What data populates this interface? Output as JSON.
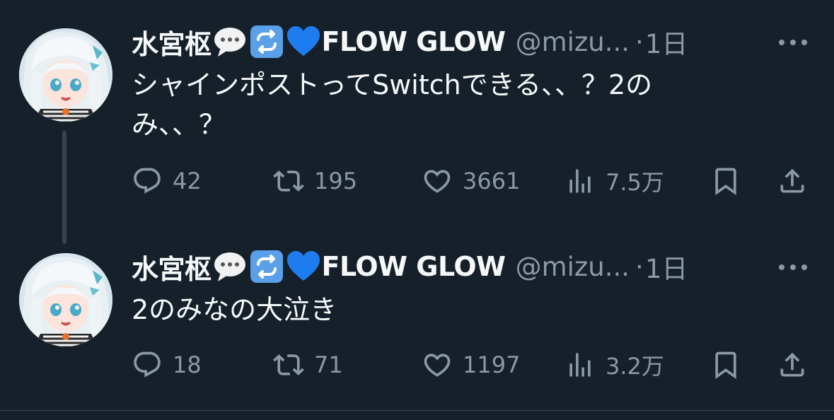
{
  "tweets": [
    {
      "author_name": "水宮枢",
      "author_name_suffix": "FLOW GLOW",
      "name_emojis": [
        "speech-balloon-emoji",
        "repeat-button-emoji",
        "blue-heart-emoji"
      ],
      "handle": "@mizu...",
      "separator": "·",
      "time": "1日",
      "text_line1": "シャインポストってSwitchできる、、？2の",
      "text_line2": "み、、？",
      "stats": {
        "replies": "42",
        "reposts": "195",
        "likes": "3661",
        "views": "7.5万"
      }
    },
    {
      "author_name": "水宮枢",
      "author_name_suffix": "FLOW GLOW",
      "name_emojis": [
        "speech-balloon-emoji",
        "repeat-button-emoji",
        "blue-heart-emoji"
      ],
      "handle": "@mizu...",
      "separator": "·",
      "time": "1日",
      "text_line1": "2のみなの大泣き",
      "stats": {
        "replies": "18",
        "reposts": "71",
        "likes": "1197",
        "views": "3.2万"
      }
    }
  ],
  "colors": {
    "background": "#15202b",
    "primary_text": "#f7f9f9",
    "secondary_text": "#8b98a5",
    "divider": "#38444d"
  }
}
